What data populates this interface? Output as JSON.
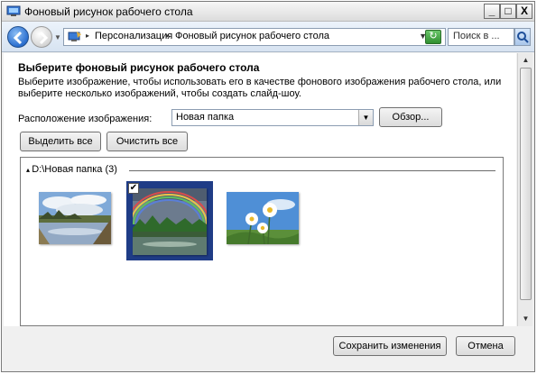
{
  "window": {
    "title": "Фоновый рисунок рабочего стола",
    "minimize": "_",
    "maximize": "□",
    "close": "X"
  },
  "nav": {
    "breadcrumbs": [
      "Персонализация",
      "Фоновый рисунок рабочего стола"
    ],
    "search_placeholder": "Поиск в ...",
    "icons": [
      "back-arrow-icon",
      "forward-arrow-icon",
      "control-panel-icon",
      "refresh-icon",
      "search-icon"
    ]
  },
  "main": {
    "heading": "Выберите фоновый рисунок рабочего стола",
    "description": "Выберите изображение, чтобы использовать его в качестве фонового изображения рабочего стола, или выберите несколько изображений, чтобы создать слайд-шоу.",
    "location_label": "Расположение изображения:",
    "location_value": "Новая папка",
    "browse_button": "Обзор...",
    "select_all_button": "Выделить все",
    "clear_all_button": "Очистить все"
  },
  "gallery": {
    "group_label": "D:\\Новая папка (3)",
    "images": [
      {
        "subject": "river-landscape",
        "selected": false
      },
      {
        "subject": "rainbow-lake",
        "selected": true
      },
      {
        "subject": "daisies-sky",
        "selected": false
      }
    ]
  },
  "footer": {
    "save_button": "Сохранить изменения",
    "cancel_button": "Отмена"
  },
  "colors": {
    "selection": "#1f3c86",
    "link_blue": "#2a6ecf"
  }
}
